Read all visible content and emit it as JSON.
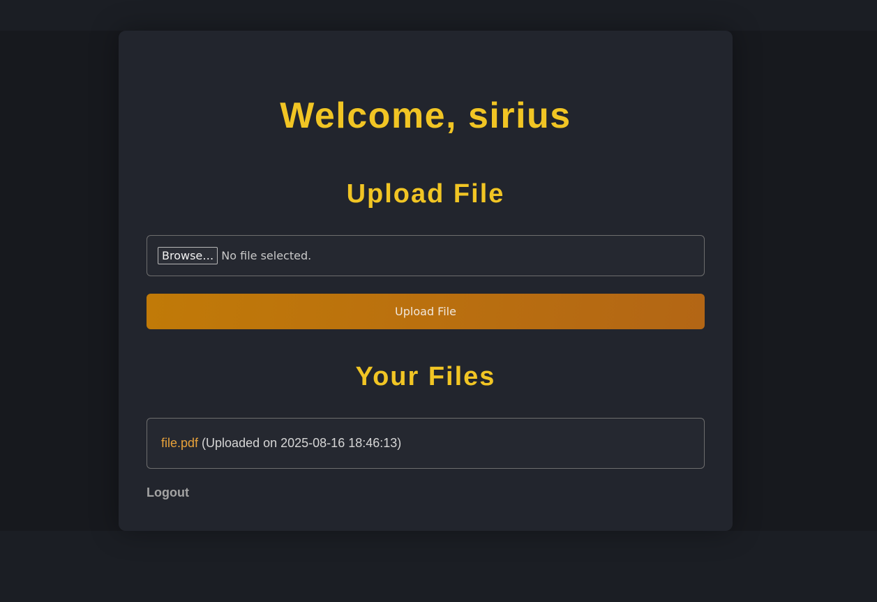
{
  "header": {
    "welcome": "Welcome, sirius"
  },
  "upload": {
    "title": "Upload File",
    "browse_label": "Browse…",
    "no_file_text": "No file selected.",
    "button_label": "Upload File"
  },
  "files": {
    "title": "Your Files",
    "items": [
      {
        "name": "file.pdf",
        "meta": "(Uploaded on 2025-08-16 18:46:13)"
      }
    ]
  },
  "nav": {
    "logout_label": "Logout"
  },
  "colors": {
    "accent": "#f1c524",
    "link": "#e8a23a",
    "button_gradient_start": "#c17a08",
    "button_gradient_end": "#b36615"
  }
}
